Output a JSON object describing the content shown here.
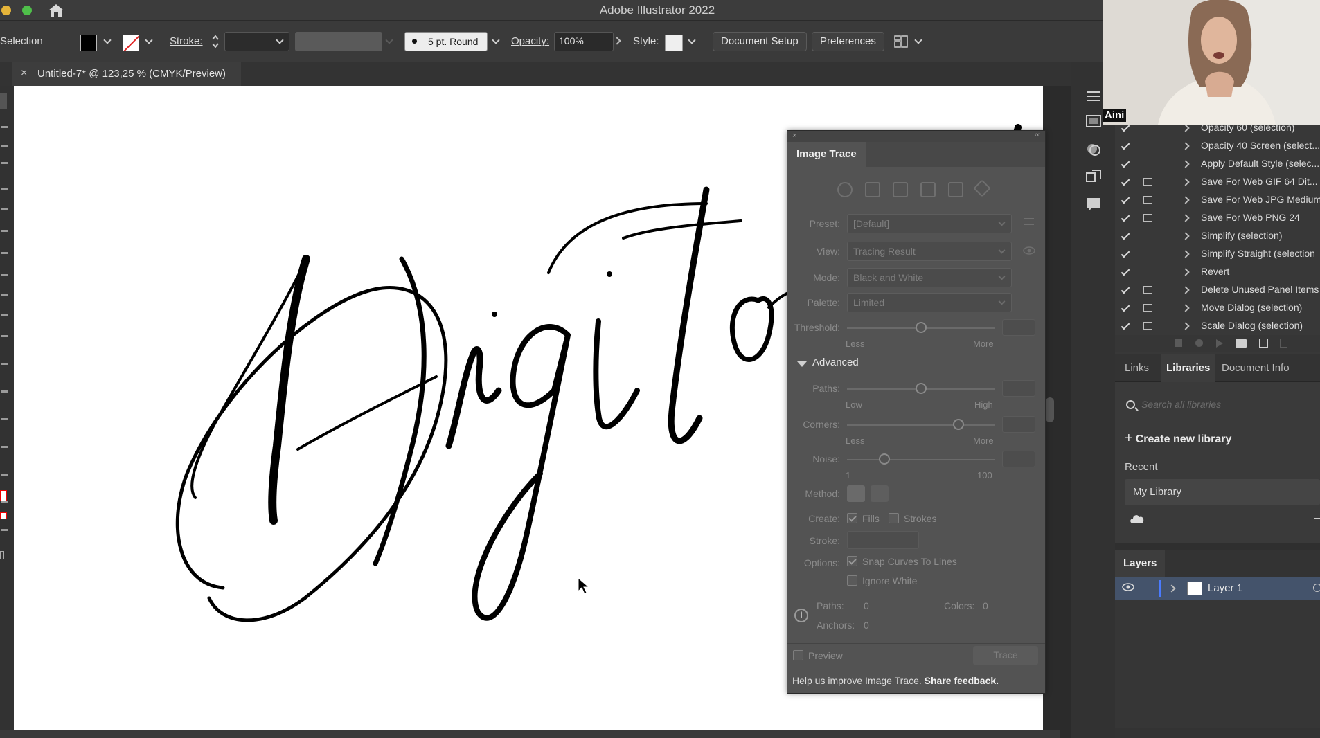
{
  "app": {
    "title": "Adobe Illustrator 2022"
  },
  "control_bar": {
    "selection_label": "Selection",
    "stroke_label": "Stroke:",
    "brush_label": "5 pt. Round",
    "opacity_label": "Opacity:",
    "opacity_value": "100%",
    "style_label": "Style:",
    "document_setup_label": "Document Setup",
    "preferences_label": "Preferences"
  },
  "document_tab": {
    "close": "×",
    "title": "Untitled-7* @ 123,25 % (CMYK/Preview)"
  },
  "image_trace": {
    "tab": "Image Trace",
    "preset_label": "Preset:",
    "preset_value": "[Default]",
    "view_label": "View:",
    "view_value": "Tracing Result",
    "mode_label": "Mode:",
    "mode_value": "Black and White",
    "palette_label": "Palette:",
    "palette_value": "Limited",
    "threshold_label": "Threshold:",
    "threshold_less": "Less",
    "threshold_more": "More",
    "advanced_label": "Advanced",
    "paths_label": "Paths:",
    "paths_low": "Low",
    "paths_high": "High",
    "corners_label": "Corners:",
    "corners_less": "Less",
    "corners_more": "More",
    "noise_label": "Noise:",
    "noise_min": "1",
    "noise_max": "100",
    "method_label": "Method:",
    "create_label": "Create:",
    "fills_label": "Fills",
    "strokes_label": "Strokes",
    "stroke_label": "Stroke:",
    "options_label": "Options:",
    "snap_label": "Snap Curves To Lines",
    "ignore_white_label": "Ignore White",
    "info_paths_label": "Paths:",
    "info_paths_value": "0",
    "info_colors_label": "Colors:",
    "info_colors_value": "0",
    "info_anchors_label": "Anchors:",
    "info_anchors_value": "0",
    "preview_label": "Preview",
    "trace_label": "Trace",
    "footer_text": "Help us improve Image Trace.",
    "footer_link": "Share feedback.",
    "fills_checked": true,
    "strokes_checked": false,
    "snap_checked": true,
    "ignore_white_checked": false,
    "preview_checked": false,
    "threshold_level": 0.5,
    "paths_level": 0.5,
    "corners_level": 0.75,
    "noise_level": 0.25
  },
  "actions": [
    {
      "label": "Opacity 60 (selection)",
      "dialog": false
    },
    {
      "label": "Opacity 40 Screen (select...",
      "dialog": false
    },
    {
      "label": "Apply Default Style (selec...",
      "dialog": false
    },
    {
      "label": "Save For Web GIF 64 Dit...",
      "dialog": true
    },
    {
      "label": "Save For Web JPG Medium",
      "dialog": true
    },
    {
      "label": "Save For Web PNG 24",
      "dialog": true
    },
    {
      "label": "Simplify (selection)",
      "dialog": false
    },
    {
      "label": "Simplify Straight (selection",
      "dialog": false
    },
    {
      "label": "Revert",
      "dialog": false
    },
    {
      "label": "Delete Unused Panel Items",
      "dialog": true
    },
    {
      "label": "Move Dialog (selection)",
      "dialog": true
    },
    {
      "label": "Scale Dialog (selection)",
      "dialog": true
    }
  ],
  "libraries": {
    "tabs": [
      "Links",
      "Libraries",
      "Document Info"
    ],
    "search_placeholder": "Search all libraries",
    "create_label": "Create new library",
    "recent_label": "Recent",
    "library_name": "My Library"
  },
  "layers": {
    "tab": "Layers",
    "layer_name": "Layer 1"
  },
  "webcam": {
    "name": "Aini"
  }
}
